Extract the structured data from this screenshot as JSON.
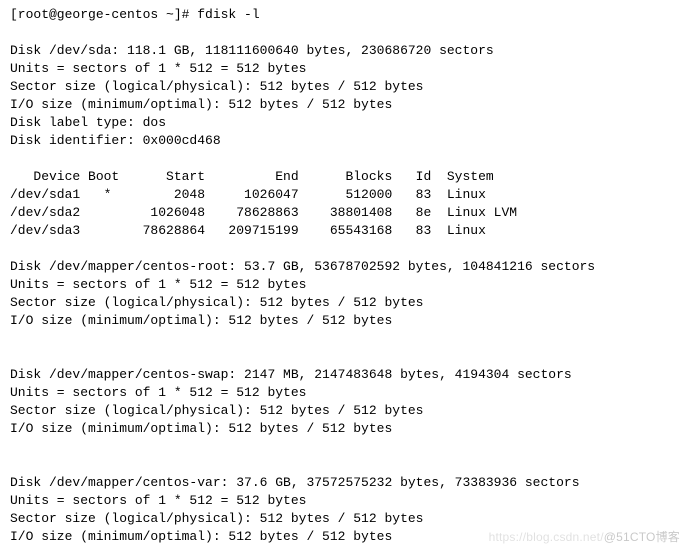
{
  "prompt": "[root@george-centos ~]# fdisk -l",
  "blank": "",
  "sda": {
    "header": "Disk /dev/sda: 118.1 GB, 118111600640 bytes, 230686720 sectors",
    "units": "Units = sectors of 1 * 512 = 512 bytes",
    "sector": "Sector size (logical/physical): 512 bytes / 512 bytes",
    "io": "I/O size (minimum/optimal): 512 bytes / 512 bytes",
    "label": "Disk label type: dos",
    "ident": "Disk identifier: 0x000cd468"
  },
  "part_header": "   Device Boot      Start         End      Blocks   Id  System",
  "parts": {
    "p1": "/dev/sda1   *        2048     1026047      512000   83  Linux",
    "p2": "/dev/sda2         1026048    78628863    38801408   8e  Linux LVM",
    "p3": "/dev/sda3        78628864   209715199    65543168   83  Linux"
  },
  "root": {
    "header": "Disk /dev/mapper/centos-root: 53.7 GB, 53678702592 bytes, 104841216 sectors",
    "units": "Units = sectors of 1 * 512 = 512 bytes",
    "sector": "Sector size (logical/physical): 512 bytes / 512 bytes",
    "io": "I/O size (minimum/optimal): 512 bytes / 512 bytes"
  },
  "swap": {
    "header": "Disk /dev/mapper/centos-swap: 2147 MB, 2147483648 bytes, 4194304 sectors",
    "units": "Units = sectors of 1 * 512 = 512 bytes",
    "sector": "Sector size (logical/physical): 512 bytes / 512 bytes",
    "io": "I/O size (minimum/optimal): 512 bytes / 512 bytes"
  },
  "var": {
    "header": "Disk /dev/mapper/centos-var: 37.6 GB, 37572575232 bytes, 73383936 sectors",
    "units": "Units = sectors of 1 * 512 = 512 bytes",
    "sector": "Sector size (logical/physical): 512 bytes / 512 bytes",
    "io": "I/O size (minimum/optimal): 512 bytes / 512 bytes"
  },
  "watermark": {
    "faint": "https://blog.csdn.net/",
    "text": "@51CTO博客"
  }
}
